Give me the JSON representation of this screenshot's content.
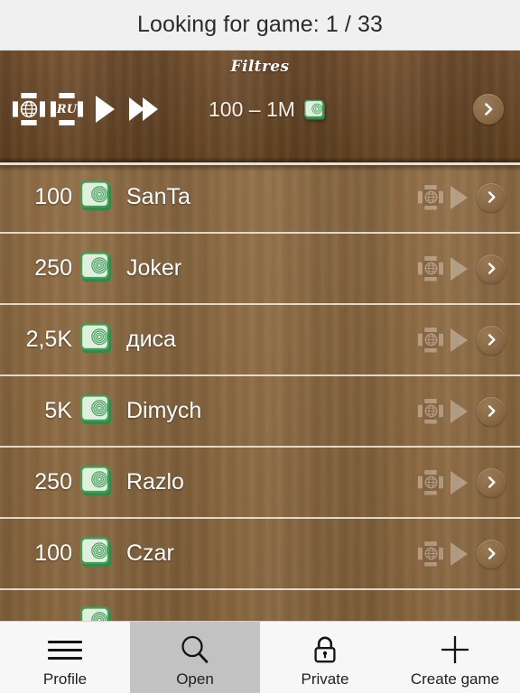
{
  "titlebar": {
    "title": "Looking for game: 1 / 33"
  },
  "filters": {
    "heading": "Filtres",
    "stakes_label": "100 – 1M",
    "money_icon": "money-stack-icon",
    "globe_icon": "globe-framed-icon",
    "language_icon_label": "RU",
    "speed_single_icon": "play-triangle-icon",
    "speed_double_icon": "fast-forward-icon",
    "go_icon": "chevron-right-icon",
    "bar_color": "#6d4b2c"
  },
  "list": {
    "divider_color": "#f6f1e8",
    "background_color": "#8d6b43",
    "columns": [
      "amount",
      "currency",
      "name",
      "region",
      "speed",
      "open"
    ],
    "rows": [
      {
        "amount": "100",
        "name": "SanTa",
        "currency_icon": "money-stack-icon",
        "region_icon": "globe-framed-icon",
        "speed_icon": "play-triangle-icon",
        "open_icon": "chevron-right-icon"
      },
      {
        "amount": "250",
        "name": "Joker",
        "currency_icon": "money-stack-icon",
        "region_icon": "globe-framed-icon",
        "speed_icon": "play-triangle-icon",
        "open_icon": "chevron-right-icon"
      },
      {
        "amount": "2,5K",
        "name": "диса",
        "currency_icon": "money-stack-icon",
        "region_icon": "globe-framed-icon",
        "speed_icon": "play-triangle-icon",
        "open_icon": "chevron-right-icon"
      },
      {
        "amount": "5K",
        "name": "Dimych",
        "currency_icon": "money-stack-icon",
        "region_icon": "globe-framed-icon",
        "speed_icon": "play-triangle-icon",
        "open_icon": "chevron-right-icon"
      },
      {
        "amount": "250",
        "name": "Razlo",
        "currency_icon": "money-stack-icon",
        "region_icon": "globe-framed-icon",
        "speed_icon": "play-triangle-icon",
        "open_icon": "chevron-right-icon"
      },
      {
        "amount": "100",
        "name": "Czar",
        "currency_icon": "money-stack-icon",
        "region_icon": "globe-framed-icon",
        "speed_icon": "play-triangle-icon",
        "open_icon": "chevron-right-icon"
      }
    ]
  },
  "tabbar": {
    "selected_color": "#c2c2c2",
    "tabs": [
      {
        "label": "Profile",
        "icon": "hamburger-menu-icon",
        "selected": false
      },
      {
        "label": "Open",
        "icon": "search-magnifier-icon",
        "selected": true
      },
      {
        "label": "Private",
        "icon": "lock-icon",
        "selected": false
      },
      {
        "label": "Create game",
        "icon": "plus-icon",
        "selected": false
      }
    ]
  }
}
